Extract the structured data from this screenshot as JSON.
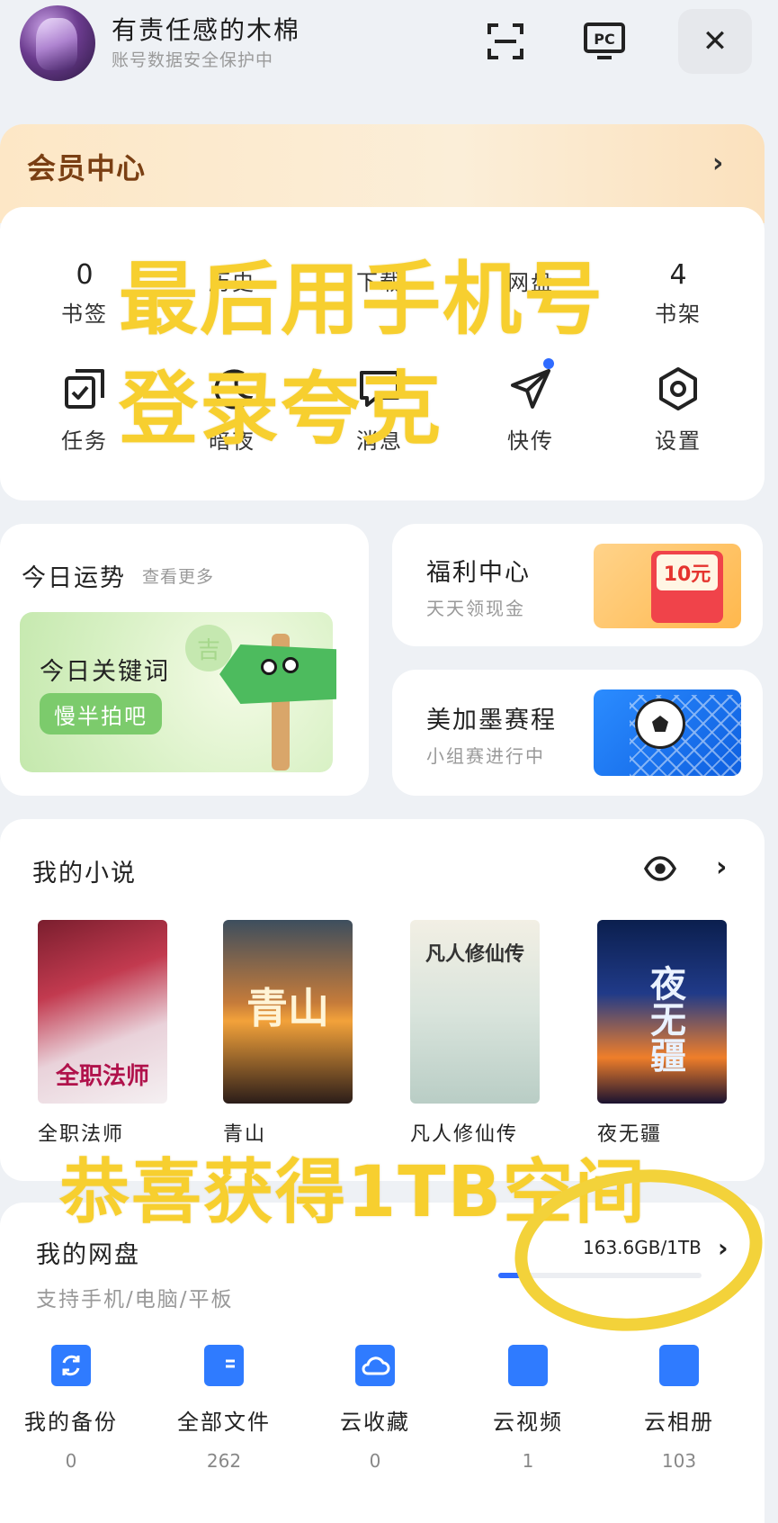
{
  "header": {
    "user_name": "有责任感的木棉",
    "user_sub": "账号数据安全保护中",
    "close_label": "✕"
  },
  "vip": {
    "title": "会员中心",
    "arrow": "›"
  },
  "stats": [
    {
      "num": "0",
      "label": "书签"
    },
    {
      "num": "",
      "label": "历史"
    },
    {
      "num": "",
      "label": "下载"
    },
    {
      "num": "",
      "label": "网盘"
    },
    {
      "num": "4",
      "label": "书架"
    }
  ],
  "tools": [
    {
      "label": "任务",
      "icon": "task-icon"
    },
    {
      "label": "暗夜",
      "icon": "night-mode-icon"
    },
    {
      "label": "消息",
      "icon": "message-icon"
    },
    {
      "label": "快传",
      "icon": "quick-transfer-icon"
    },
    {
      "label": "设置",
      "icon": "settings-icon"
    }
  ],
  "fortune": {
    "title": "今日运势",
    "more": "查看更多",
    "keyword_title": "今日关键词",
    "keyword": "慢半拍吧",
    "badge": "吉"
  },
  "welfare": {
    "title": "福利中心",
    "sub": "天天领现金",
    "badge": "10元"
  },
  "match": {
    "title": "美加墨赛程",
    "sub": "小组赛进行中"
  },
  "novels": {
    "title": "我的小说",
    "arrow": "›",
    "books": [
      {
        "name": "全职法师",
        "cover_text": "全职法师"
      },
      {
        "name": "青山",
        "cover_text": "青山"
      },
      {
        "name": "凡人修仙传",
        "cover_text": "凡人修仙传"
      },
      {
        "name": "夜无疆",
        "cover_text": "夜无疆"
      }
    ]
  },
  "drive": {
    "title": "我的网盘",
    "sub": "支持手机/电脑/平板",
    "usage": "163.6GB/1TB",
    "usage_fraction": 0.16,
    "arrow": "›",
    "items": [
      {
        "label": "我的备份",
        "count": "0"
      },
      {
        "label": "全部文件",
        "count": "262"
      },
      {
        "label": "云收藏",
        "count": "0"
      },
      {
        "label": "云视频",
        "count": "1"
      },
      {
        "label": "云相册",
        "count": "103"
      }
    ]
  },
  "overlays": {
    "line1": "最后用手机号",
    "line2": "登录夸克",
    "line3": "恭喜获得1TB空间"
  },
  "colors": {
    "accent": "#2f6bff",
    "overlay_yellow": "#f7cf2f",
    "vip_text": "#7a3f13"
  }
}
